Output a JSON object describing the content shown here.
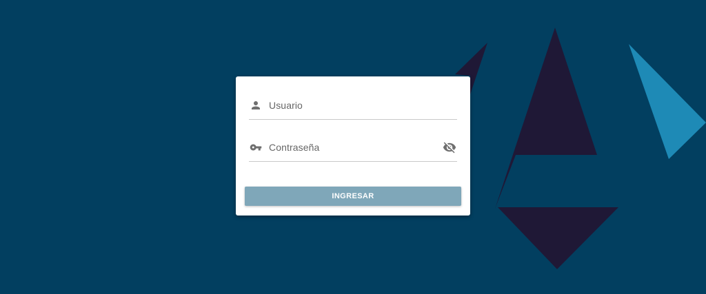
{
  "login": {
    "username_placeholder": "Usuario",
    "password_placeholder": "Contraseña",
    "submit_label": "INGRESAR"
  },
  "icons": {
    "user": "user-icon",
    "key": "key-icon",
    "visibility_off": "eye-off-icon"
  },
  "colors": {
    "background": "#023f60",
    "shape_dark": "#1f1836",
    "shape_light": "#1e8ab6",
    "button": "#7fa7b9",
    "icon": "#6f6f6f"
  }
}
